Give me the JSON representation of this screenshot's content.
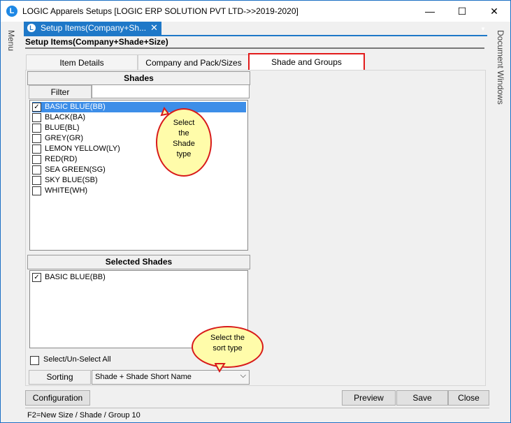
{
  "window": {
    "title": "LOGIC Apparels Setups  [LOGIC ERP SOLUTION PVT LTD->>2019-2020]",
    "minimize": "—",
    "maximize": "☐",
    "close": "✕"
  },
  "side": {
    "left_label": "Menu",
    "right_label": "Document Windows"
  },
  "doc_tab": {
    "label": "Setup Items(Company+Sh...",
    "close": "✕"
  },
  "form_title": "Setup Items(Company+Shade+Size)",
  "tabs": [
    {
      "label": "Item Details"
    },
    {
      "label": "Company and Pack/Sizes"
    },
    {
      "label": "Shade and Groups"
    }
  ],
  "shades": {
    "header": "Shades",
    "filter_label": "Filter",
    "filter_value": "",
    "items": [
      {
        "label": "BASIC BLUE(BB)",
        "checked": true,
        "selected": true
      },
      {
        "label": "BLACK(BA)",
        "checked": false
      },
      {
        "label": "BLUE(BL)",
        "checked": false
      },
      {
        "label": "GREY(GR)",
        "checked": false
      },
      {
        "label": "LEMON YELLOW(LY)",
        "checked": false
      },
      {
        "label": "RED(RD)",
        "checked": false
      },
      {
        "label": "SEA GREEN(SG)",
        "checked": false
      },
      {
        "label": "SKY BLUE(SB)",
        "checked": false
      },
      {
        "label": "WHITE(WH)",
        "checked": false
      }
    ]
  },
  "selected_shades": {
    "header": "Selected Shades",
    "items": [
      {
        "label": "BASIC BLUE(BB)",
        "checked": true
      }
    ]
  },
  "callouts": {
    "shade": [
      "Select",
      "the",
      "Shade",
      "type"
    ],
    "sort": [
      "Select   the",
      "sort  type"
    ]
  },
  "select_all_label": "Select/Un-Select All",
  "sorting": {
    "label": "Sorting",
    "value": "Shade + Shade Short Name"
  },
  "buttons": {
    "configuration": "Configuration",
    "preview": "Preview",
    "save": "Save",
    "close": "Close"
  },
  "status_text": "F2=New Size / Shade / Group 10",
  "colors": {
    "accent": "#1e78c8",
    "selection": "#3d8ee8",
    "highlight": "#e21b1b",
    "callout_fill": "#fffcaa"
  }
}
